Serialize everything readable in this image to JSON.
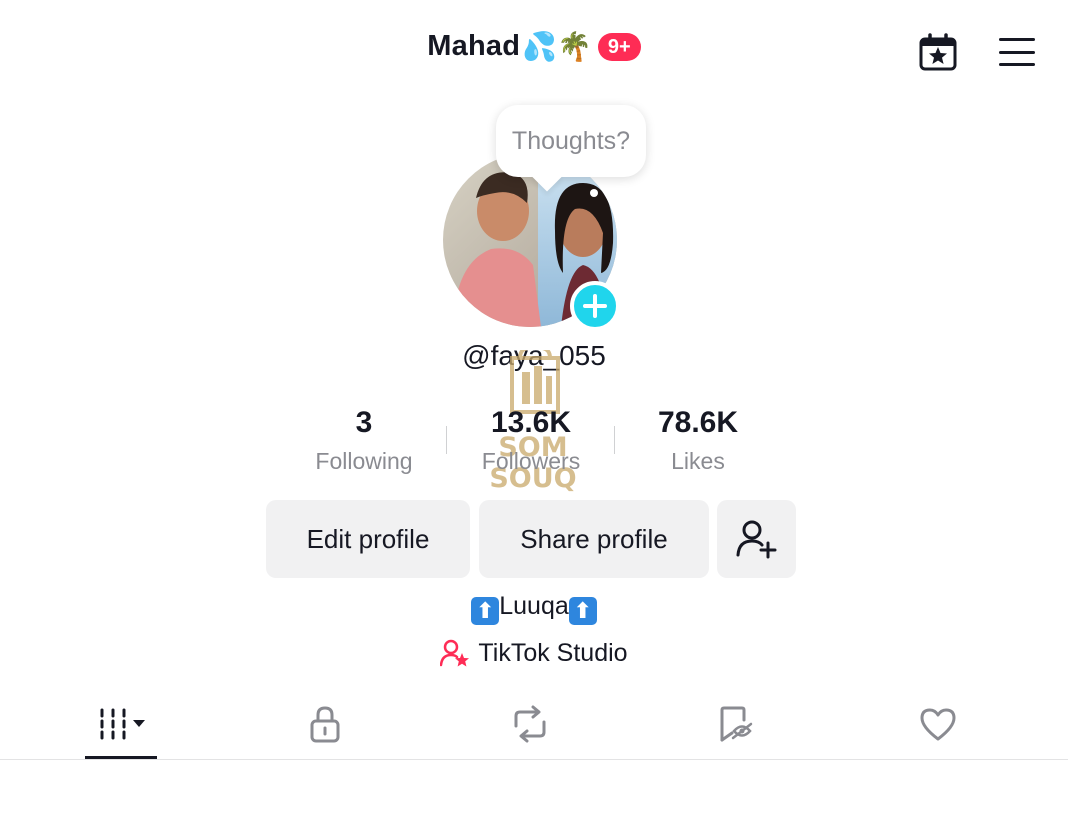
{
  "header": {
    "title": "Mahad",
    "title_emoji": "💦🌴",
    "notification_badge": "9+",
    "calendar_icon": "calendar-star-icon",
    "menu_icon": "hamburger-menu-icon"
  },
  "profile": {
    "story_prompt": "Thoughts?",
    "username": "@faya_055",
    "watermark_text": "SOM SOUQ"
  },
  "stats": [
    {
      "value": "3",
      "label": "Following"
    },
    {
      "value": "13.6K",
      "label": "Followers"
    },
    {
      "value": "78.6K",
      "label": "Likes"
    }
  ],
  "actions": {
    "edit_profile": "Edit profile",
    "share_profile": "Share profile",
    "add_friend_icon": "add-user-icon"
  },
  "bio": {
    "arrow_symbol": "⬆",
    "text": "Luuqa"
  },
  "studio": {
    "label": "TikTok Studio"
  },
  "tabs": [
    {
      "icon": "videos-grid-icon",
      "active": true
    },
    {
      "icon": "lock-icon",
      "active": false
    },
    {
      "icon": "repost-icon",
      "active": false
    },
    {
      "icon": "favorites-icon",
      "active": false
    },
    {
      "icon": "heart-icon",
      "active": false
    }
  ],
  "colors": {
    "accent": "#fe2c55",
    "story_add": "#20d5ec",
    "button_bg": "#f1f1f2",
    "muted_text": "#8a8b91"
  }
}
